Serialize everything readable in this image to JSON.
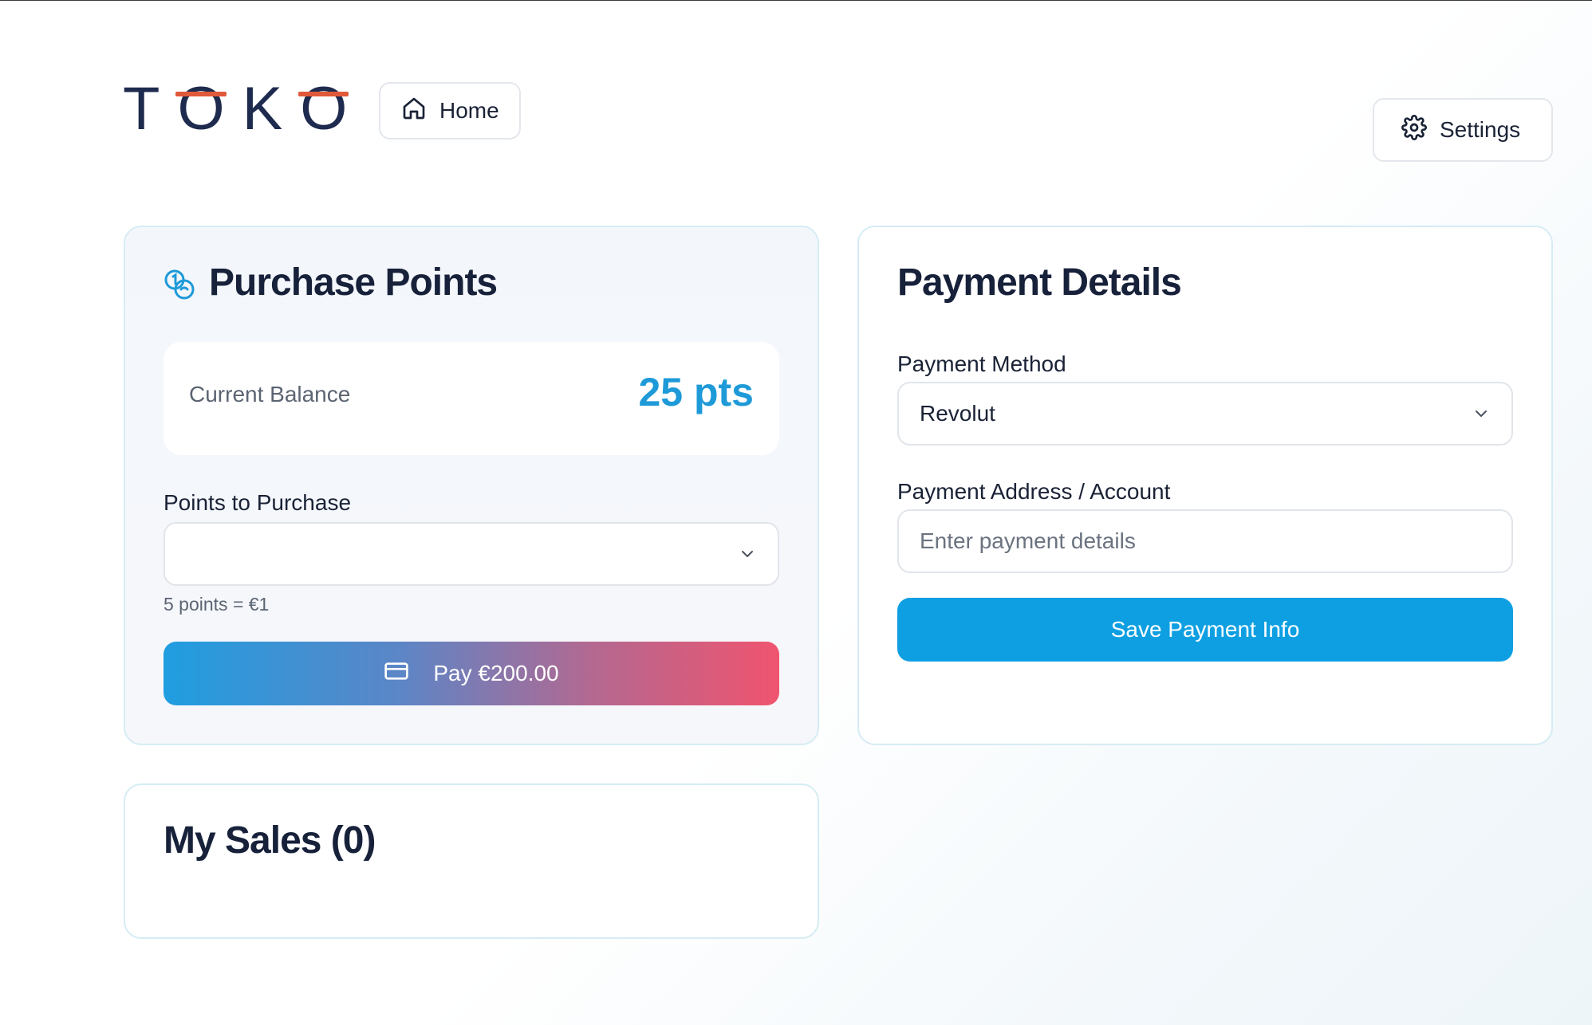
{
  "header": {
    "logo_text_parts": [
      "T",
      "O",
      "K",
      "O"
    ],
    "home_label": "Home",
    "settings_label": "Settings"
  },
  "purchase": {
    "title": "Purchase Points",
    "balance_label": "Current Balance",
    "balance_value": "25 pts",
    "points_label": "Points to Purchase",
    "points_selected": "",
    "rate_note": "5 points = €1",
    "pay_label": "Pay €200.00"
  },
  "payment": {
    "title": "Payment Details",
    "method_label": "Payment Method",
    "method_selected": "Revolut",
    "address_label": "Payment Address / Account",
    "address_placeholder": "Enter payment details",
    "save_label": "Save Payment Info"
  },
  "sales": {
    "title": "My Sales (0)"
  },
  "colors": {
    "brand_navy": "#1e2a4e",
    "brand_accent": "#e0593a",
    "balance_blue": "#1e9ad8",
    "save_button": "#0e9fe2",
    "pay_gradient_start": "#1f9ee0",
    "pay_gradient_end": "#f0546f"
  },
  "icons": {
    "home": "home-icon",
    "settings": "gear-icon",
    "coins": "coins-icon",
    "card": "credit-card-icon",
    "chevron": "chevron-down-icon"
  }
}
